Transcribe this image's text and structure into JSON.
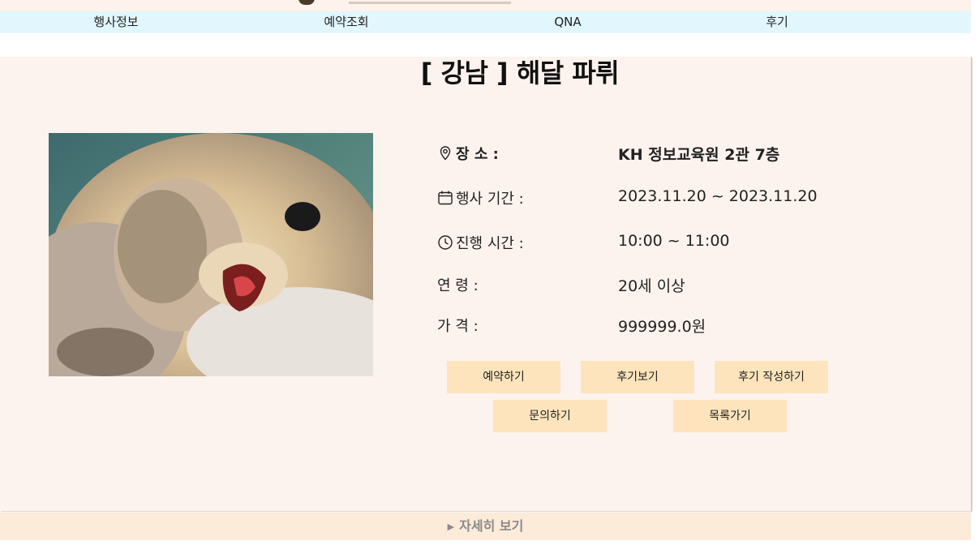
{
  "nav": {
    "items": [
      {
        "label": "행사정보"
      },
      {
        "label": "예약조회"
      },
      {
        "label": "QNA"
      },
      {
        "label": "후기"
      }
    ]
  },
  "event": {
    "title": "[ 강남 ] 해달 파뤼",
    "image_icon": "sea-otter-photo",
    "info": [
      {
        "icon": "location-pin-icon",
        "label": "장 소 :",
        "value": "KH 정보교육원 2관 7층"
      },
      {
        "icon": "calendar-icon",
        "label": "행사 기간 :",
        "value": "2023.11.20 ~ 2023.11.20"
      },
      {
        "icon": "clock-icon",
        "label": "진행 시간 :",
        "value": "10:00 ~ 11:00"
      },
      {
        "label": "연 령 :",
        "value": "20세 이상"
      },
      {
        "label": "가 격 :",
        "value": "999999.0원"
      }
    ]
  },
  "actions": {
    "reserve": "예약하기",
    "view_reviews": "후기보기",
    "write_review": "후기 작성하기",
    "inquiry": "문의하기",
    "back_to_list": "목록가기"
  },
  "details": {
    "label": "자세히 보기"
  },
  "colors": {
    "nav_bg": "#e2f6fd",
    "card_bg": "#fcf3ee",
    "button_bg": "#fde4bd",
    "details_bg": "#fcebd8"
  }
}
